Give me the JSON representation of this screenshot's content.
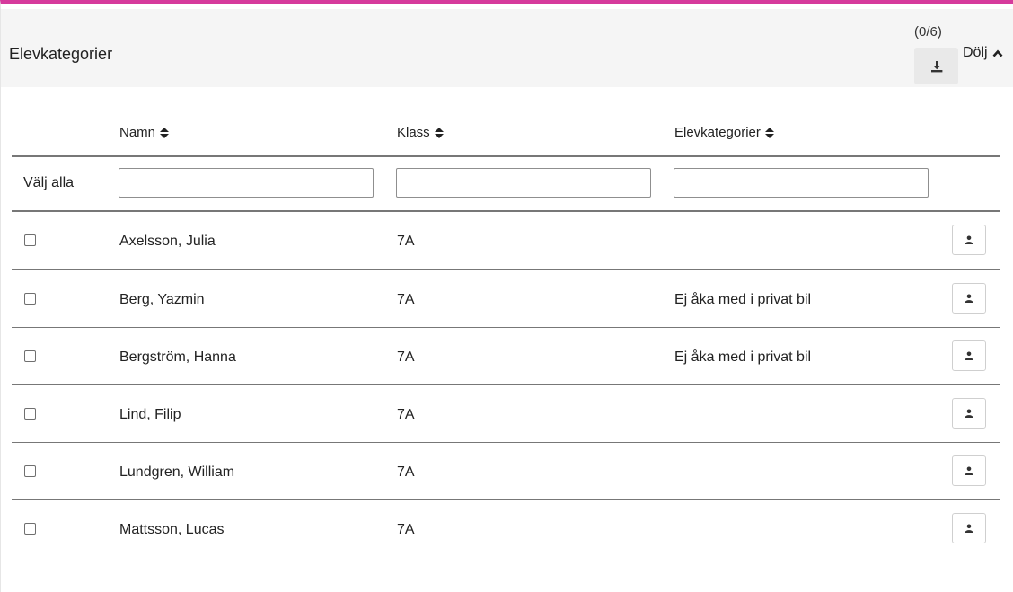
{
  "panel": {
    "title": "Elevkategorier",
    "count": "(0/6)",
    "toggle_label": "Dölj",
    "accent_color": "#d63a9c"
  },
  "table": {
    "columns": [
      "Namn",
      "Klass",
      "Elevkategorier"
    ],
    "select_all_label": "Välj alla",
    "filters": [
      "",
      "",
      ""
    ],
    "rows": [
      {
        "name": "Axelsson, Julia",
        "class": "7A",
        "category": ""
      },
      {
        "name": "Berg, Yazmin",
        "class": "7A",
        "category": "Ej åka med i privat bil"
      },
      {
        "name": "Bergström, Hanna",
        "class": "7A",
        "category": "Ej åka med i privat bil"
      },
      {
        "name": "Lind, Filip",
        "class": "7A",
        "category": ""
      },
      {
        "name": "Lundgren, William",
        "class": "7A",
        "category": ""
      },
      {
        "name": "Mattsson, Lucas",
        "class": "7A",
        "category": ""
      }
    ]
  },
  "icons": {
    "download": "download-icon",
    "toggle": "chevron-up-icon",
    "sort": "sort-icon",
    "profile": "user-icon"
  }
}
